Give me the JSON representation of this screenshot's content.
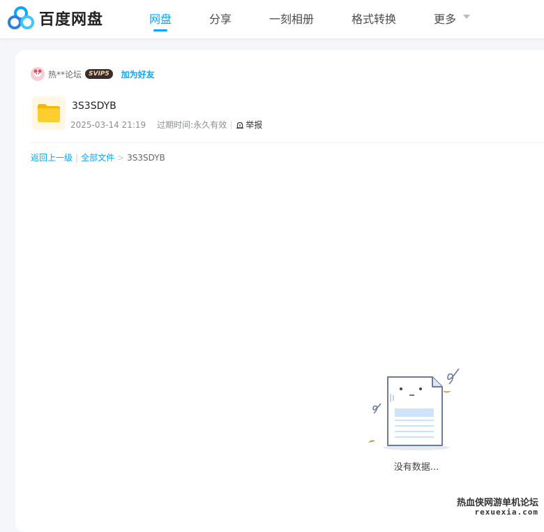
{
  "header": {
    "logo_text": "百度网盘",
    "nav": [
      {
        "label": "网盘",
        "active": true
      },
      {
        "label": "分享",
        "active": false
      },
      {
        "label": "一刻相册",
        "active": false
      },
      {
        "label": "格式转换",
        "active": false
      },
      {
        "label": "更多",
        "active": false
      }
    ]
  },
  "share": {
    "owner_name": "热**论坛",
    "vip_badge": "SVIP5",
    "add_friend_label": "加为好友",
    "file": {
      "name": "3S3SDYB",
      "icon": "folder-icon",
      "date": "2025-03-14 21:19",
      "expiry_label": "过期时间:",
      "expiry_value": "永久有效",
      "report_label": "举报"
    }
  },
  "breadcrumb": {
    "back": "返回上一级",
    "separator": "|",
    "all_files": "全部文件",
    "arrow": ">",
    "current": "3S3SDYB"
  },
  "empty_state": {
    "text": "没有数据..."
  },
  "watermark": {
    "line1": "热血侠网游单机论坛",
    "line2": "rexuexia.com"
  },
  "colors": {
    "accent": "#06a7ff",
    "folder": "#ffcd2e",
    "page_bg": "#f5f6f9"
  }
}
